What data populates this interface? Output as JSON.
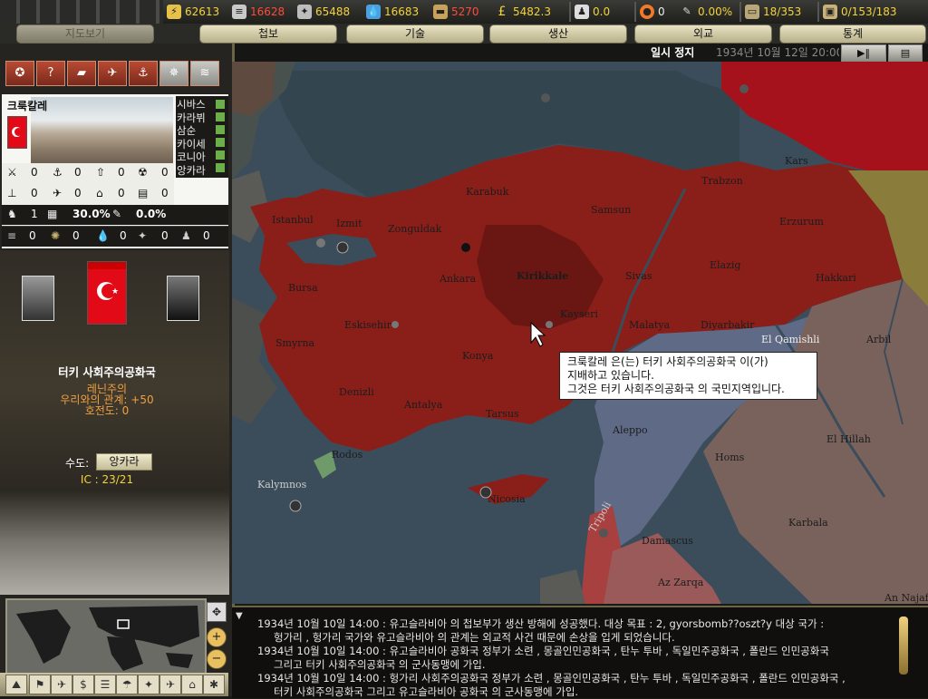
{
  "resources": [
    {
      "icon": "energy-icon",
      "value": "62613",
      "color": "#f4d23a"
    },
    {
      "icon": "metal-icon",
      "value": "16628",
      "color": "#ff4a3a"
    },
    {
      "icon": "rare-materials-icon",
      "value": "65488",
      "color": "#f4d23a"
    },
    {
      "icon": "oil-icon",
      "value": "16683",
      "color": "#f4d23a"
    },
    {
      "icon": "supplies-icon",
      "value": "5270",
      "color": "#ff4a3a"
    },
    {
      "icon": "money-icon",
      "value": "5482.3",
      "color": "#f4d23a"
    },
    {
      "icon": "manpower-icon",
      "value": "0.0",
      "color": "#f4d23a"
    },
    {
      "icon": "nuke-icon",
      "value": "0",
      "color": "#eeeeee"
    },
    {
      "icon": "dissent-icon",
      "value": "0.00%",
      "color": "#f4d23a"
    },
    {
      "icon": "transport-icon",
      "value": "18/353",
      "color": "#f4d23a"
    },
    {
      "icon": "convoy-icon",
      "value": "0/153/183",
      "color": "#f4d23a"
    }
  ],
  "tabs": {
    "map": "지도보기",
    "intel": "첩보",
    "tech": "기술",
    "production": "생산",
    "diplomacy": "외교",
    "stats": "통계"
  },
  "status": {
    "paused": "일시 정지",
    "date": "1934년 10월 12일 20:00"
  },
  "province": {
    "name": "크룩칼레",
    "buildings": [
      "시바스",
      "카라뷔",
      "삼순",
      "카이세",
      "코니아",
      "앙카라"
    ],
    "stats": {
      "infantry": "0",
      "navalbase": "0",
      "rocket": "0",
      "nuclear": "0",
      "flak": "0",
      "airbase": "0",
      "industry": "0",
      "supply": "0",
      "resistance": "1",
      "infra_pct": "30.0%",
      "dissent_pct": "0.0%",
      "energy": "0",
      "rare": "0",
      "oil": "0",
      "metal": "0",
      "manpower": "0"
    }
  },
  "nation": {
    "name": "터키 사회주의공화국",
    "ideology": "레닌주의",
    "relation": "우리와의 관계: +50",
    "belligerence": "호전도: 0",
    "capital_label": "수도:",
    "capital": "앙카라",
    "ic": "IC : 23/21"
  },
  "map_labels": {
    "karabuk": "Karabuk",
    "samsun": "Samsun",
    "trabzon": "Trabzon",
    "kars": "Kars",
    "zonguldak": "Zonguldak",
    "istanbul": "Istanbul",
    "izmit": "Izmit",
    "erzurum": "Erzurum",
    "ankara": "Ankara",
    "kirikkale": "Kirikkale",
    "sivas": "Sivas",
    "elazig": "Elazig",
    "hakkari": "Hakkari",
    "bursa": "Bursa",
    "eskisehir": "Eskisehir",
    "malatya": "Malatya",
    "diyarbakir": "Diyarbakir",
    "kayseri": "Kayseri",
    "smyrna": "Smyrna",
    "konya": "Konya",
    "elqamishli": "El Qamishli",
    "arbil": "Arbil",
    "denizli": "Denizli",
    "antalya": "Antalya",
    "tarsus": "Tarsus",
    "aleppo": "Aleppo",
    "elhillah": "El Hillah",
    "homs": "Homs",
    "rodos": "Rodos",
    "nicosia": "Nicosia",
    "damascus": "Damascus",
    "karbala": "Karbala",
    "anajaf": "An Najaf",
    "azzarqa": "Az Zarqa",
    "kalymnos": "Kalymnos",
    "tripoli": "Tripoli"
  },
  "tooltip": {
    "line1": "크룩칼레 은(는) 터키 사회주의공화국 이(가)",
    "line2": "지배하고 있습니다.",
    "line3": "그것은 터키 사회주의공화국 의 국민지역입니다."
  },
  "log": [
    "1934년 10월 10일 14:00  : 유고슬라비아 의 첩보부가 생산 방해에 성공했다. 대상 목표 : 2, gyorsbomb??oszt?y 대상 국가 :",
    "헝가리 , 헝가리 국가와 유고슬라비아 의 관계는 외교적 사건 때문에 손상을 입게 되었습니다.",
    "1934년 10월 10일 14:00  : 유고슬라비아 공화국 정부가 소련 , 몽골인민공화국 , 탄누 투바 , 독일민주공화국 , 폴란드 인민공화국",
    "그리고 터키 사회주의공화국 의 군사동맹에 가입.",
    "1934년 10월 10일 14:00  : 헝가리 사회주의공화국 정부가 소련 , 몽골인민공화국 , 탄누 투바 , 독일민주공화국 , 폴란드 인민공화국 ,",
    "터키 사회주의공화국  그리고 유고슬라비아 공화국 의 군사동맹에 가입."
  ],
  "colors": {
    "turkey": "#8a1f1a",
    "kirikkale": "#6a1612",
    "syria": "#5f6a86",
    "iraq": "#7a625c",
    "sea": "#3b4c5a",
    "ussr": "#a5121c"
  }
}
